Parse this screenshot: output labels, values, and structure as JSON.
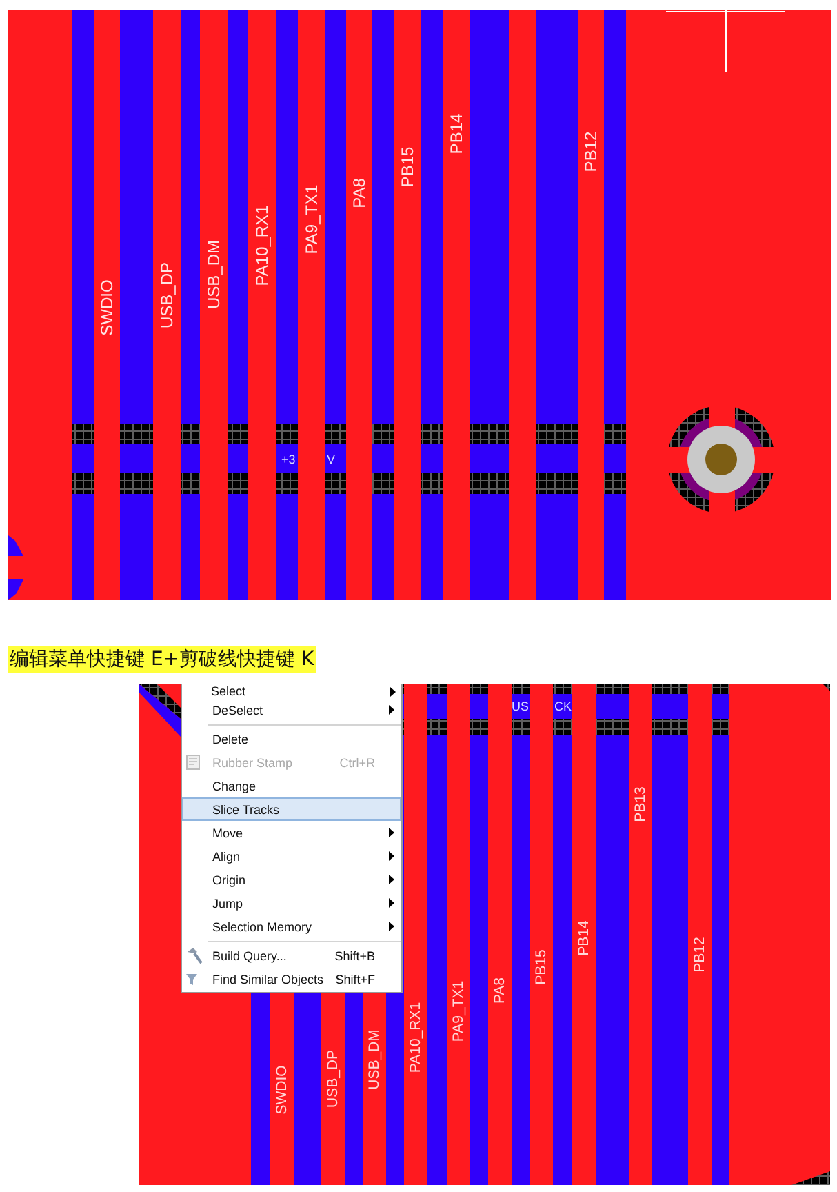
{
  "top_view": {
    "net_labels": [
      "SWDIO",
      "USB_DP",
      "USB_DM",
      "PA10_RX1",
      "PA9_TX1",
      "PA8",
      "PB15",
      "PB14",
      "PB12"
    ],
    "net_label_fragments": [
      "+3",
      "V"
    ]
  },
  "caption": "编辑菜单快捷键 E+剪破线快捷键 K",
  "bottom_view": {
    "context_menu": {
      "sections": [
        {
          "items": [
            {
              "label": "Select",
              "submenu": true,
              "selected": false,
              "disabled": false
            },
            {
              "label": "DeSelect",
              "submenu": true,
              "selected": false,
              "disabled": false
            }
          ]
        },
        {
          "items": [
            {
              "label": "Delete",
              "submenu": false,
              "selected": false,
              "disabled": false
            },
            {
              "label": "Rubber Stamp",
              "shortcut": "Ctrl+R",
              "submenu": false,
              "selected": false,
              "disabled": true
            },
            {
              "label": "Change",
              "submenu": false,
              "selected": false,
              "disabled": false
            },
            {
              "label": "Slice Tracks",
              "submenu": false,
              "selected": true,
              "disabled": false
            },
            {
              "label": "Move",
              "submenu": true,
              "selected": false,
              "disabled": false
            },
            {
              "label": "Align",
              "submenu": true,
              "selected": false,
              "disabled": false
            },
            {
              "label": "Origin",
              "submenu": true,
              "selected": false,
              "disabled": false
            },
            {
              "label": "Jump",
              "submenu": true,
              "selected": false,
              "disabled": false
            },
            {
              "label": "Selection Memory",
              "submenu": true,
              "selected": false,
              "disabled": false
            }
          ]
        },
        {
          "items": [
            {
              "label": "Build Query...",
              "shortcut": "Shift+B",
              "submenu": false,
              "selected": false,
              "disabled": false
            },
            {
              "label": "Find Similar Objects",
              "shortcut": "Shift+F",
              "submenu": false,
              "selected": false,
              "disabled": false
            }
          ]
        }
      ]
    },
    "net_label_fragments": [
      "US",
      "CK"
    ],
    "net_labels": [
      "SWDIO",
      "USB_DP",
      "USB_DM",
      "PA10_RX1",
      "PA9_TX1",
      "PA8",
      "PB15",
      "PB14",
      "PB13",
      "PB12"
    ]
  }
}
